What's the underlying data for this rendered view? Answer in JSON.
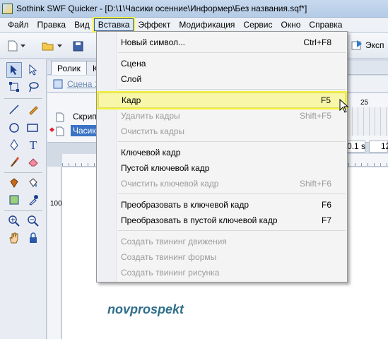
{
  "window": {
    "title": "Sothink SWF Quicker - [D:\\1\\Часики осенние\\Информер\\Без названия.sqf*]"
  },
  "menubar": {
    "items": [
      "Файл",
      "Правка",
      "Вид",
      "Вставка",
      "Эффект",
      "Модификация",
      "Сервис",
      "Окно",
      "Справка"
    ],
    "active_index": 3
  },
  "toolbar": {
    "export_label": "Эксп"
  },
  "timeline": {
    "tab_label": "Ролик",
    "tab2_label": "К",
    "scene_link": "Сцена 1",
    "layers": [
      "Скрип",
      "Часик"
    ],
    "frame_number": "25",
    "time_value": "0.1 s",
    "time_value2": "12"
  },
  "ruler": {
    "left_label": "100"
  },
  "stage": {
    "watermark": "novprospekt"
  },
  "dropdown": {
    "groups": [
      [
        {
          "label": "Новый символ...",
          "shortcut": "Ctrl+F8",
          "enabled": true
        }
      ],
      [
        {
          "label": "Сцена",
          "shortcut": "",
          "enabled": true
        },
        {
          "label": "Слой",
          "shortcut": "",
          "enabled": true
        }
      ],
      [
        {
          "label": "Кадр",
          "shortcut": "F5",
          "enabled": true,
          "highlighted": true
        },
        {
          "label": "Удалить кадры",
          "shortcut": "Shift+F5",
          "enabled": false
        },
        {
          "label": "Очистить кадры",
          "shortcut": "",
          "enabled": false
        }
      ],
      [
        {
          "label": "Ключевой кадр",
          "shortcut": "",
          "enabled": true
        },
        {
          "label": "Пустой ключевой кадр",
          "shortcut": "",
          "enabled": true
        },
        {
          "label": "Очистить ключевой кадр",
          "shortcut": "Shift+F6",
          "enabled": false
        }
      ],
      [
        {
          "label": "Преобразовать в ключевой кадр",
          "shortcut": "F6",
          "enabled": true
        },
        {
          "label": "Преобразовать в пустой ключевой кадр",
          "shortcut": "F7",
          "enabled": true
        }
      ],
      [
        {
          "label": "Создать твининг движения",
          "shortcut": "",
          "enabled": false
        },
        {
          "label": "Создать твининг формы",
          "shortcut": "",
          "enabled": false
        },
        {
          "label": "Создать твининг рисунка",
          "shortcut": "",
          "enabled": false
        }
      ]
    ]
  },
  "colors": {
    "highlight": "#f2f23e",
    "selection_blue": "#3a73c6",
    "watermark": "#2f6e8a"
  }
}
